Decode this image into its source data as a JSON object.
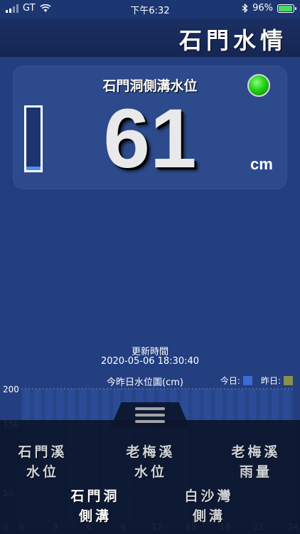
{
  "status_bar": {
    "carrier": "GT",
    "time": "下午6:32",
    "battery": "96%",
    "battery_level": 0.96
  },
  "app": {
    "title": "石門水情"
  },
  "card": {
    "title": "石門洞側溝水位",
    "value": "61",
    "unit": "cm",
    "status_color": "#23d11a",
    "gauge_level": 0.06
  },
  "update": {
    "label": "更新時間",
    "time": "2020-05-06 18:30:40"
  },
  "chart_data": {
    "type": "bar",
    "title": "今昨日水位圖(cm)",
    "legend": [
      {
        "name": "今日:",
        "color": "#3b6cd4"
      },
      {
        "name": "昨日:",
        "color": "#8a8f4d"
      }
    ],
    "y_ticks": [
      "200",
      "150",
      "50",
      "0"
    ],
    "x_ticks": [
      "0",
      "3",
      "6",
      "9",
      "12",
      "15",
      "18",
      "21",
      "24"
    ],
    "ylim": [
      0,
      200
    ],
    "xlim": [
      0,
      24
    ],
    "grid": true
  },
  "nav": {
    "items": [
      {
        "line1": "石門溪",
        "line2": "水位"
      },
      {
        "line1": "老梅溪",
        "line2": "水位"
      },
      {
        "line1": "老梅溪",
        "line2": "雨量"
      },
      {
        "line1": "石門洞",
        "line2": "側溝"
      },
      {
        "line1": "白沙灣",
        "line2": "側溝"
      }
    ]
  }
}
